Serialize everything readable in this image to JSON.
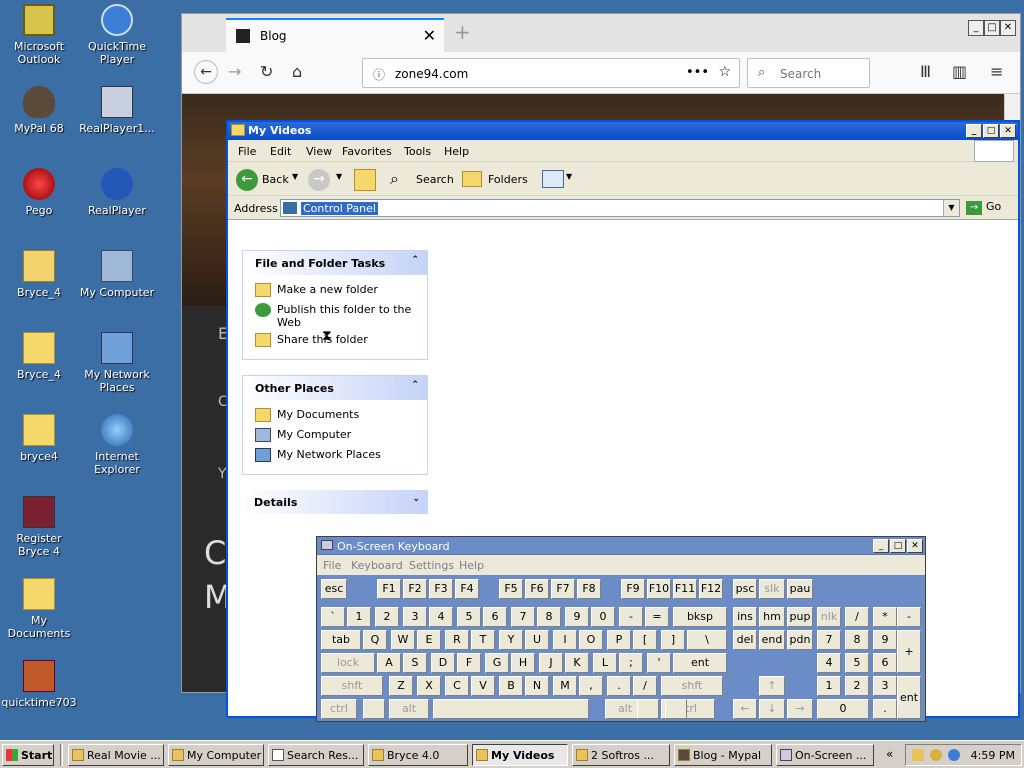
{
  "desktop": {
    "icons": [
      {
        "label": "Microsoft Outlook"
      },
      {
        "label": "QuickTime Player"
      },
      {
        "label": "MyPal 68"
      },
      {
        "label": "RealPlayer1..."
      },
      {
        "label": "Pego"
      },
      {
        "label": "RealPlayer"
      },
      {
        "label": "Bryce_4"
      },
      {
        "label": "My Computer"
      },
      {
        "label": "Bryce_4"
      },
      {
        "label": "My Network Places"
      },
      {
        "label": "bryce4"
      },
      {
        "label": "Internet Explorer"
      },
      {
        "label": "Register Bryce 4"
      },
      {
        "label": "My Documents"
      },
      {
        "label": "quicktime703"
      }
    ]
  },
  "firefox": {
    "tab_title": "Blog",
    "url": "zone94.com",
    "search_placeholder": "Search",
    "page_chars": [
      "E",
      "C",
      "Y",
      "C",
      "M"
    ]
  },
  "explorer": {
    "title": "My Videos",
    "menu": [
      "File",
      "Edit",
      "View",
      "Favorites",
      "Tools",
      "Help"
    ],
    "toolbar": {
      "back": "Back",
      "search": "Search",
      "folders": "Folders"
    },
    "address_label": "Address",
    "address_value": "Control Panel",
    "go": "Go",
    "panels": {
      "tasks": {
        "title": "File and Folder Tasks",
        "items": [
          "Make a new folder",
          "Publish this folder to the Web",
          "Share this folder"
        ]
      },
      "other": {
        "title": "Other Places",
        "items": [
          "My Documents",
          "My Computer",
          "My Network Places"
        ]
      },
      "details": {
        "title": "Details"
      }
    }
  },
  "osk": {
    "title": "On-Screen Keyboard",
    "menu": [
      "File",
      "Keyboard",
      "Settings",
      "Help"
    ],
    "rows": {
      "r1": [
        "esc",
        "F1",
        "F2",
        "F3",
        "F4",
        "F5",
        "F6",
        "F7",
        "F8",
        "F9",
        "F10",
        "F11",
        "F12",
        "psc",
        "slk",
        "pau"
      ],
      "r2": [
        "`",
        "1",
        "2",
        "3",
        "4",
        "5",
        "6",
        "7",
        "8",
        "9",
        "0",
        "-",
        "=",
        "bksp",
        "ins",
        "hm",
        "pup",
        "nlk",
        "/",
        "*",
        "-"
      ],
      "r3": [
        "tab",
        "Q",
        "W",
        "E",
        "R",
        "T",
        "Y",
        "U",
        "I",
        "O",
        "P",
        "[",
        "]",
        "\\",
        "del",
        "end",
        "pdn",
        "7",
        "8",
        "9",
        "+"
      ],
      "r4": [
        "lock",
        "A",
        "S",
        "D",
        "F",
        "G",
        "H",
        "J",
        "K",
        "L",
        ";",
        "'",
        "ent",
        "4",
        "5",
        "6"
      ],
      "r5": [
        "shft",
        "Z",
        "X",
        "C",
        "V",
        "B",
        "N",
        "M",
        ",",
        ".",
        "/",
        "shft",
        "↑",
        "1",
        "2",
        "3",
        "ent"
      ],
      "r6": [
        "ctrl",
        "alt",
        "alt",
        "ctrl",
        "←",
        "↓",
        "→",
        "0",
        "."
      ]
    }
  },
  "taskbar": {
    "start": "Start",
    "buttons": [
      "Real Movie ...",
      "My Computer",
      "Search Res...",
      "Bryce 4.0",
      "My Videos",
      "2 Softros ...",
      "Blog - Mypal",
      "On-Screen ..."
    ],
    "clock": "4:59 PM"
  }
}
